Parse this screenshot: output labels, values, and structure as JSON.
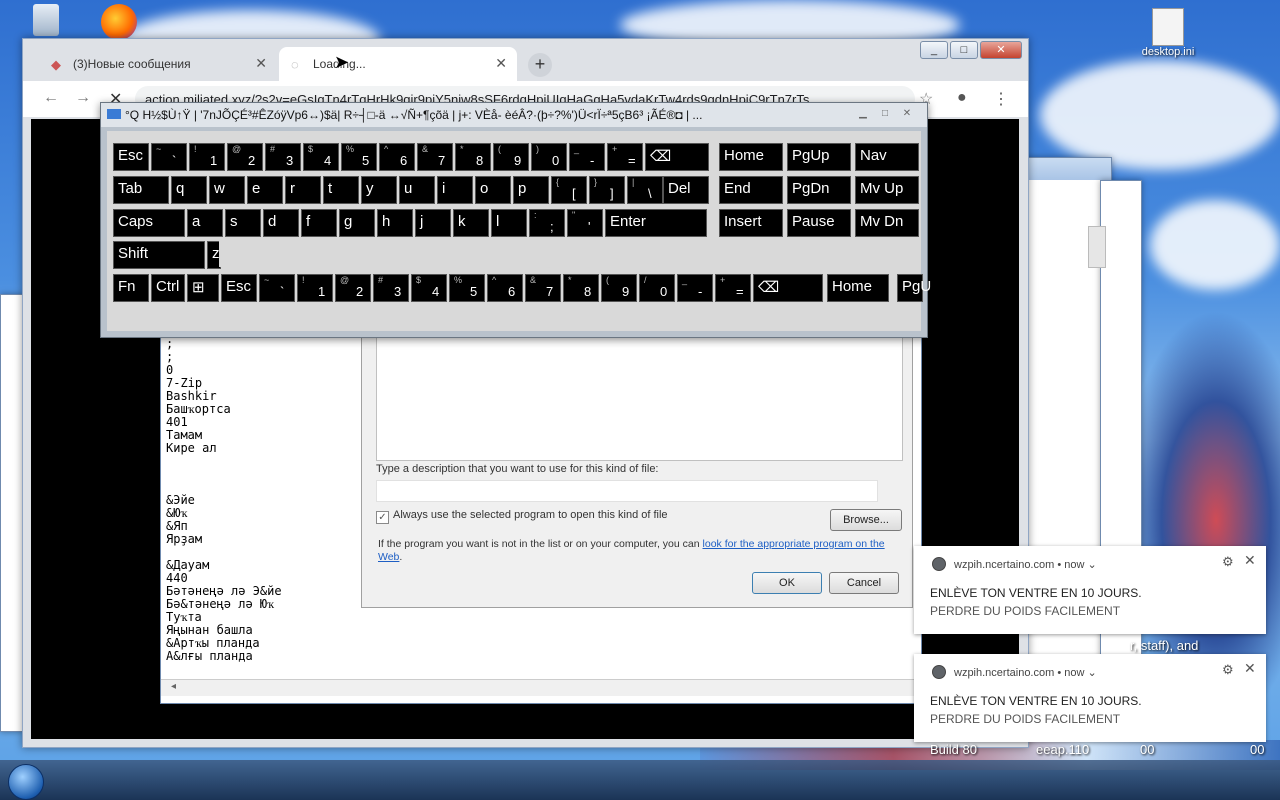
{
  "desktop": {
    "icons": [
      {
        "name": "desktop.ini"
      }
    ],
    "bg_text": [
      "r, staff), and",
      "Build 80",
      "eeap.110",
      "00",
      "00"
    ]
  },
  "browser": {
    "tabs": [
      {
        "label": "(3)Новые сообщения",
        "state": "inactive"
      },
      {
        "label": "Loading...",
        "state": "active"
      }
    ],
    "url": "action.miliated.xyz/?s2v=eGsIqTn4rTqHrHk9qir9pjY5njw8sSF6rdqHpiUIqHaGqHa5vdaKrTw4rds9qdnHpjC9rTn7rTs",
    "window_buttons": [
      "_",
      "□",
      "✕"
    ]
  },
  "osk": {
    "title": "°Q    H½$Ù↑Ÿ | '7nJÕÇÉ³#ÊZóÿVp6↔)$ä| R÷┤□-ä ↔√Ñ+¶çõä | j+: VÈå- èéÂ?·(þ÷?%')Ü<rÏ÷ª5çB6³    ¡ÃÉ®◘ | ...",
    "rows": [
      [
        {
          "label": "Esc"
        },
        {
          "shift": "~",
          "base": "`"
        },
        {
          "shift": "!",
          "base": "1"
        },
        {
          "shift": "@",
          "base": "2"
        },
        {
          "shift": "#",
          "base": "3"
        },
        {
          "shift": "$",
          "base": "4"
        },
        {
          "shift": "%",
          "base": "5"
        },
        {
          "shift": "^",
          "base": "6"
        },
        {
          "shift": "&",
          "base": "7"
        },
        {
          "shift": "*",
          "base": "8"
        },
        {
          "shift": "(",
          "base": "9"
        },
        {
          "shift": ")",
          "base": "0"
        },
        {
          "shift": "_",
          "base": "-"
        },
        {
          "shift": "+",
          "base": "="
        },
        {
          "label": "⌫"
        },
        {
          "label": "Home"
        },
        {
          "label": "PgUp"
        },
        {
          "label": "Nav"
        }
      ],
      [
        {
          "label": "Tab"
        },
        {
          "label": "q"
        },
        {
          "label": "w"
        },
        {
          "label": "e"
        },
        {
          "label": "r"
        },
        {
          "label": "t"
        },
        {
          "label": "y"
        },
        {
          "label": "u"
        },
        {
          "label": "i"
        },
        {
          "label": "o"
        },
        {
          "label": "p"
        },
        {
          "shift": "{",
          "base": "["
        },
        {
          "shift": "}",
          "base": "]"
        },
        {
          "shift": "|",
          "base": "\\"
        },
        {
          "label": "Del"
        },
        {
          "label": "End"
        },
        {
          "label": "PgDn"
        },
        {
          "label": "Mv Up"
        }
      ],
      [
        {
          "label": "Caps"
        },
        {
          "label": "a"
        },
        {
          "label": "s"
        },
        {
          "label": "d"
        },
        {
          "label": "f"
        },
        {
          "label": "g"
        },
        {
          "label": "h"
        },
        {
          "label": "j"
        },
        {
          "label": "k"
        },
        {
          "label": "l"
        },
        {
          "shift": ":",
          "base": ";"
        },
        {
          "shift": "\"",
          "base": "'"
        },
        {
          "label": "Enter"
        },
        {
          "label": "Insert"
        },
        {
          "label": "Pause"
        },
        {
          "label": "Mv Dn"
        }
      ],
      [
        {
          "label": "Shift"
        },
        {
          "label": "z"
        }
      ],
      [
        {
          "label": "Fn"
        },
        {
          "label": "Ctrl"
        },
        {
          "label": "⊞"
        },
        {
          "label": "Esc"
        },
        {
          "shift": "~",
          "base": "`"
        },
        {
          "shift": "!",
          "base": "1"
        },
        {
          "shift": "@",
          "base": "2"
        },
        {
          "shift": "#",
          "base": "3"
        },
        {
          "shift": "$",
          "base": "4"
        },
        {
          "shift": "%",
          "base": "5"
        },
        {
          "shift": "^",
          "base": "6"
        },
        {
          "shift": "&",
          "base": "7"
        },
        {
          "shift": "*",
          "base": "8"
        },
        {
          "shift": "(",
          "base": "9"
        },
        {
          "shift": "/",
          "base": "0"
        },
        {
          "shift": "_",
          "base": "-"
        },
        {
          "shift": "+",
          "base": "="
        },
        {
          "label": "⌫"
        },
        {
          "label": "Home"
        },
        {
          "label": "PgU"
        }
      ]
    ]
  },
  "text_list": [
    ";",
    ";",
    "0",
    "7-Zip",
    "Bashkir",
    "Башҡортса",
    "401",
    "Тамам",
    "Кире ал",
    "",
    "",
    "",
    "&Эйе",
    "&Юҡ",
    "&Яп",
    "Ярҙам",
    "",
    "&Дауам",
    "440",
    "Бәтәнеңә лә Э&йе",
    "Бә&тәнеңә лә Юҡ",
    "Туҡта",
    "Яңынан башла",
    "&Артҡы планда",
    "А&лғы планда"
  ],
  "dialog": {
    "desc_label": "Type a description that you want to use for this kind of file:",
    "desc_value": "",
    "always_use": "Always use the selected program to open this kind of file",
    "always_checked": "✓",
    "browse": "Browse...",
    "info_prefix": "If the program you want is not in the list or on your computer, you can ",
    "info_link": "look for the appropriate program on the Web",
    "info_suffix": ".",
    "ok": "OK",
    "cancel": "Cancel"
  },
  "notifications": [
    {
      "source": "wzpih.ncertaino.com",
      "time": "now",
      "title": "ENLÈVE TON VENTRE EN 10 JOURS.",
      "body": "PERDRE DU POIDS FACILEMENT"
    },
    {
      "source": "wzpih.ncertaino.com",
      "time": "now",
      "title": "ENLÈVE TON VENTRE EN 10 JOURS.",
      "body": "PERDRE DU POIDS FACILEMENT"
    }
  ],
  "colors": {
    "link": "#1e5fc4",
    "osk_key": "#000000",
    "osk_body": "#d9d9d9"
  }
}
